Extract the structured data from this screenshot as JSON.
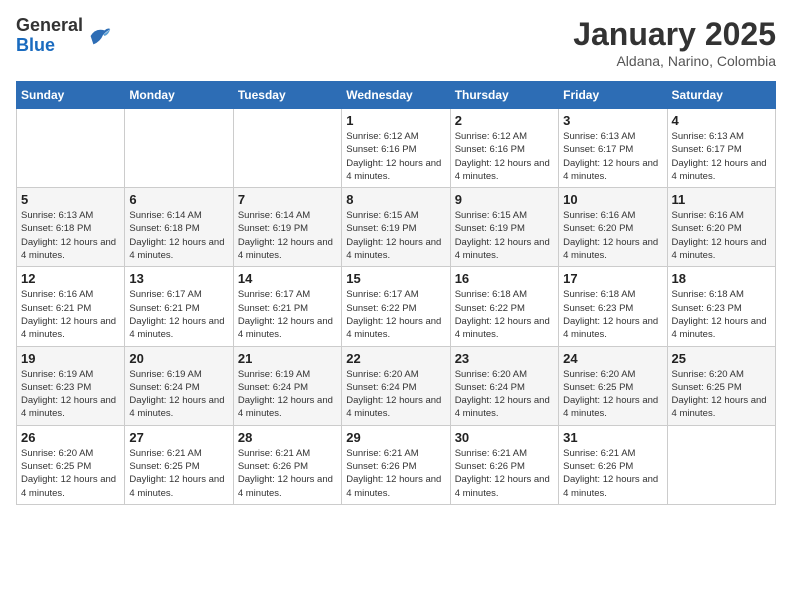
{
  "logo": {
    "general": "General",
    "blue": "Blue"
  },
  "header": {
    "month_title": "January 2025",
    "subtitle": "Aldana, Narino, Colombia"
  },
  "days_of_week": [
    "Sunday",
    "Monday",
    "Tuesday",
    "Wednesday",
    "Thursday",
    "Friday",
    "Saturday"
  ],
  "weeks": [
    [
      {
        "day": "",
        "info": ""
      },
      {
        "day": "",
        "info": ""
      },
      {
        "day": "",
        "info": ""
      },
      {
        "day": "1",
        "info": "Sunrise: 6:12 AM\nSunset: 6:16 PM\nDaylight: 12 hours and 4 minutes."
      },
      {
        "day": "2",
        "info": "Sunrise: 6:12 AM\nSunset: 6:16 PM\nDaylight: 12 hours and 4 minutes."
      },
      {
        "day": "3",
        "info": "Sunrise: 6:13 AM\nSunset: 6:17 PM\nDaylight: 12 hours and 4 minutes."
      },
      {
        "day": "4",
        "info": "Sunrise: 6:13 AM\nSunset: 6:17 PM\nDaylight: 12 hours and 4 minutes."
      }
    ],
    [
      {
        "day": "5",
        "info": "Sunrise: 6:13 AM\nSunset: 6:18 PM\nDaylight: 12 hours and 4 minutes."
      },
      {
        "day": "6",
        "info": "Sunrise: 6:14 AM\nSunset: 6:18 PM\nDaylight: 12 hours and 4 minutes."
      },
      {
        "day": "7",
        "info": "Sunrise: 6:14 AM\nSunset: 6:19 PM\nDaylight: 12 hours and 4 minutes."
      },
      {
        "day": "8",
        "info": "Sunrise: 6:15 AM\nSunset: 6:19 PM\nDaylight: 12 hours and 4 minutes."
      },
      {
        "day": "9",
        "info": "Sunrise: 6:15 AM\nSunset: 6:19 PM\nDaylight: 12 hours and 4 minutes."
      },
      {
        "day": "10",
        "info": "Sunrise: 6:16 AM\nSunset: 6:20 PM\nDaylight: 12 hours and 4 minutes."
      },
      {
        "day": "11",
        "info": "Sunrise: 6:16 AM\nSunset: 6:20 PM\nDaylight: 12 hours and 4 minutes."
      }
    ],
    [
      {
        "day": "12",
        "info": "Sunrise: 6:16 AM\nSunset: 6:21 PM\nDaylight: 12 hours and 4 minutes."
      },
      {
        "day": "13",
        "info": "Sunrise: 6:17 AM\nSunset: 6:21 PM\nDaylight: 12 hours and 4 minutes."
      },
      {
        "day": "14",
        "info": "Sunrise: 6:17 AM\nSunset: 6:21 PM\nDaylight: 12 hours and 4 minutes."
      },
      {
        "day": "15",
        "info": "Sunrise: 6:17 AM\nSunset: 6:22 PM\nDaylight: 12 hours and 4 minutes."
      },
      {
        "day": "16",
        "info": "Sunrise: 6:18 AM\nSunset: 6:22 PM\nDaylight: 12 hours and 4 minutes."
      },
      {
        "day": "17",
        "info": "Sunrise: 6:18 AM\nSunset: 6:23 PM\nDaylight: 12 hours and 4 minutes."
      },
      {
        "day": "18",
        "info": "Sunrise: 6:18 AM\nSunset: 6:23 PM\nDaylight: 12 hours and 4 minutes."
      }
    ],
    [
      {
        "day": "19",
        "info": "Sunrise: 6:19 AM\nSunset: 6:23 PM\nDaylight: 12 hours and 4 minutes."
      },
      {
        "day": "20",
        "info": "Sunrise: 6:19 AM\nSunset: 6:24 PM\nDaylight: 12 hours and 4 minutes."
      },
      {
        "day": "21",
        "info": "Sunrise: 6:19 AM\nSunset: 6:24 PM\nDaylight: 12 hours and 4 minutes."
      },
      {
        "day": "22",
        "info": "Sunrise: 6:20 AM\nSunset: 6:24 PM\nDaylight: 12 hours and 4 minutes."
      },
      {
        "day": "23",
        "info": "Sunrise: 6:20 AM\nSunset: 6:24 PM\nDaylight: 12 hours and 4 minutes."
      },
      {
        "day": "24",
        "info": "Sunrise: 6:20 AM\nSunset: 6:25 PM\nDaylight: 12 hours and 4 minutes."
      },
      {
        "day": "25",
        "info": "Sunrise: 6:20 AM\nSunset: 6:25 PM\nDaylight: 12 hours and 4 minutes."
      }
    ],
    [
      {
        "day": "26",
        "info": "Sunrise: 6:20 AM\nSunset: 6:25 PM\nDaylight: 12 hours and 4 minutes."
      },
      {
        "day": "27",
        "info": "Sunrise: 6:21 AM\nSunset: 6:25 PM\nDaylight: 12 hours and 4 minutes."
      },
      {
        "day": "28",
        "info": "Sunrise: 6:21 AM\nSunset: 6:26 PM\nDaylight: 12 hours and 4 minutes."
      },
      {
        "day": "29",
        "info": "Sunrise: 6:21 AM\nSunset: 6:26 PM\nDaylight: 12 hours and 4 minutes."
      },
      {
        "day": "30",
        "info": "Sunrise: 6:21 AM\nSunset: 6:26 PM\nDaylight: 12 hours and 4 minutes."
      },
      {
        "day": "31",
        "info": "Sunrise: 6:21 AM\nSunset: 6:26 PM\nDaylight: 12 hours and 4 minutes."
      },
      {
        "day": "",
        "info": ""
      }
    ]
  ]
}
